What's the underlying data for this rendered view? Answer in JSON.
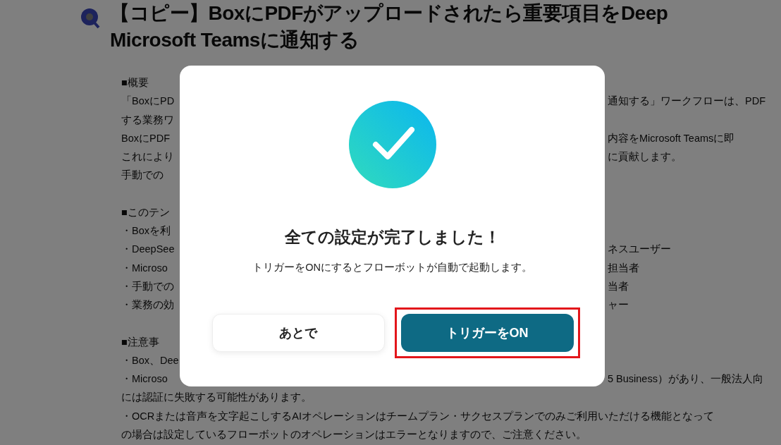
{
  "page": {
    "title_lines": [
      "【コピー】BoxにPDFがアップロードされたら重要項目をDeep",
      "Microsoft Teamsに通知する"
    ],
    "sections": [
      {
        "lines": [
          {
            "left": "■概要"
          },
          {
            "left": "「BoxにPD",
            "right": "通知する」ワークフローは、PDF"
          },
          {
            "left": "する業務ワ"
          },
          {
            "left": "BoxにPDF",
            "right": "内容をMicrosoft Teamsに即"
          },
          {
            "left": "これにより",
            "right": "に貢献します。"
          },
          {
            "left": "手動での"
          }
        ]
      },
      {
        "lines": [
          {
            "left": "■このテン"
          },
          {
            "left": "・Boxを利"
          },
          {
            "left": "・DeepSee",
            "right": "ネスユーザー"
          },
          {
            "left": "・Microso",
            "right": "担当者"
          },
          {
            "left": "・手動での",
            "right": "当者"
          },
          {
            "left": "・業務の効",
            "right": "ャー"
          }
        ]
      },
      {
        "lines": [
          {
            "left": "■注意事"
          },
          {
            "left": "・Box、Dee"
          },
          {
            "left": "・Microso",
            "right": "5 Business）があり、一般法人向"
          },
          {
            "left": "には認証に失敗する可能性があります。"
          },
          {
            "left": "・OCRまたは音声を文字起こしするAIオペレーションはチームプラン・サクセスプランでのみご利用いただける機能となって"
          },
          {
            "left": "の場合は設定しているフローボットのオペレーションはエラーとなりますので、ご注意ください。"
          }
        ]
      }
    ]
  },
  "dialog": {
    "title": "全ての設定が完了しました！",
    "message": "トリガーをONにするとフローボットが自動で起動します。",
    "buttons": [
      {
        "label": "あとで",
        "kind": "secondary",
        "highlighted": false
      },
      {
        "label": "トリガーをON",
        "kind": "primary",
        "highlighted": true
      }
    ]
  }
}
